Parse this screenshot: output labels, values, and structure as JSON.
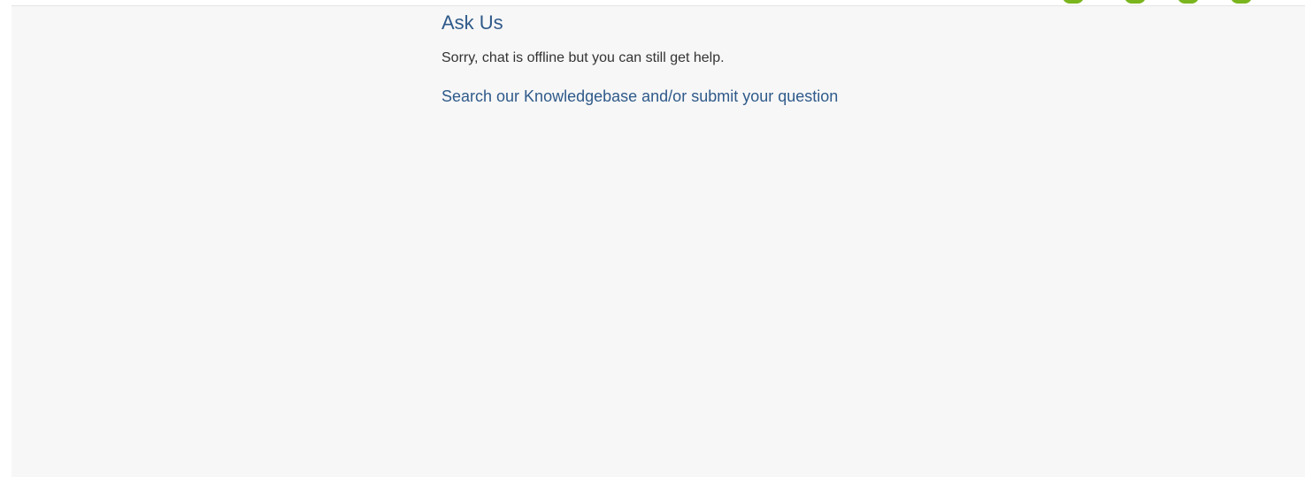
{
  "widget": {
    "title": "Ask Us",
    "message": "Sorry, chat is offline but you can still get help.",
    "link_label": "Search our Knowledgebase and/or submit your question"
  },
  "colors": {
    "title": "#2f5a8a",
    "link": "#2f5a8a",
    "text": "#333333",
    "panel_bg": "#f7f7f7",
    "accent": "#7ab51d"
  }
}
